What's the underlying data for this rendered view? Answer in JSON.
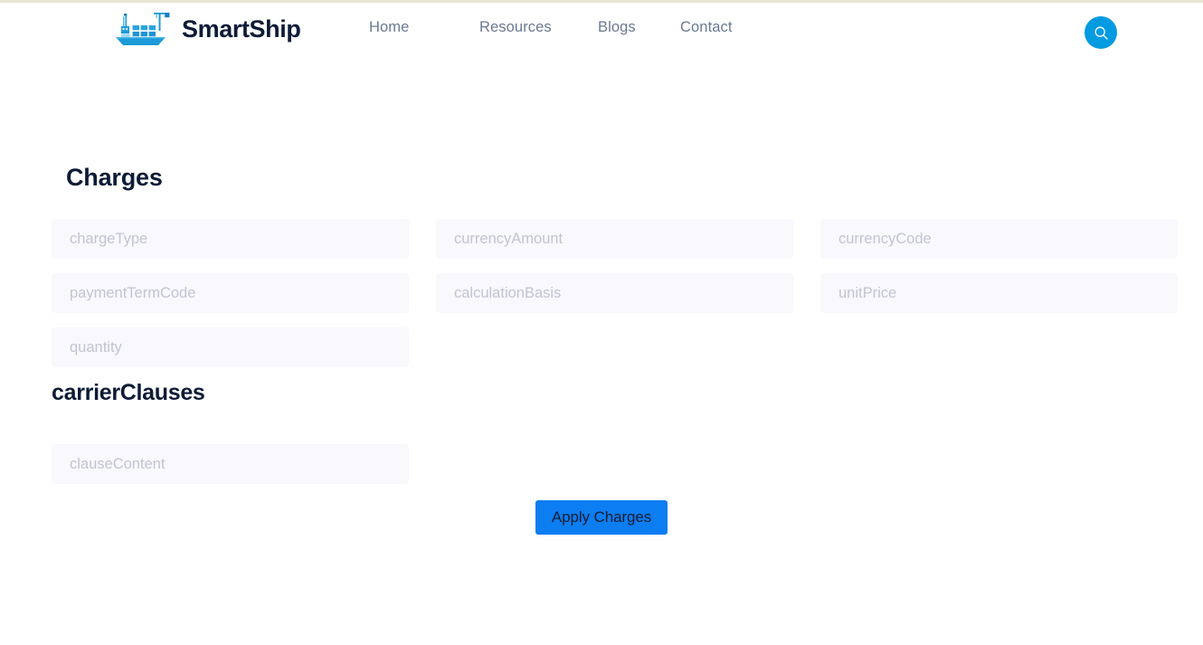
{
  "theme": {
    "brand_navy": "#0d1b37",
    "accent_blue": "#029ae0",
    "button_blue": "#0d7df2",
    "field_bg": "#f8f8fd",
    "placeholder_gray": "#c2c4d0",
    "nav_gray": "#6a7a93",
    "top_rule": "#e8e4d2"
  },
  "header": {
    "brand_name": "SmartShip",
    "logo_icon": "cargo-ship-icon",
    "nav": [
      {
        "label": "Home"
      },
      {
        "label": "Resources"
      },
      {
        "label": "Blogs"
      },
      {
        "label": "Contact"
      }
    ],
    "search": {
      "icon": "search-icon",
      "label": "Search"
    }
  },
  "main": {
    "charges": {
      "title": "Charges",
      "fields": [
        {
          "name": "chargeType",
          "placeholder": "chargeType",
          "value": ""
        },
        {
          "name": "currencyAmount",
          "placeholder": "currencyAmount",
          "value": ""
        },
        {
          "name": "currencyCode",
          "placeholder": "currencyCode",
          "value": ""
        },
        {
          "name": "paymentTermCode",
          "placeholder": "paymentTermCode",
          "value": ""
        },
        {
          "name": "calculationBasis",
          "placeholder": "calculationBasis",
          "value": ""
        },
        {
          "name": "unitPrice",
          "placeholder": "unitPrice",
          "value": ""
        },
        {
          "name": "quantity",
          "placeholder": "quantity",
          "value": ""
        }
      ]
    },
    "carrier_clauses": {
      "title": "carrierClauses",
      "fields": [
        {
          "name": "clauseContent",
          "placeholder": "clauseContent",
          "value": ""
        }
      ]
    },
    "apply_button_label": "Apply Charges"
  }
}
